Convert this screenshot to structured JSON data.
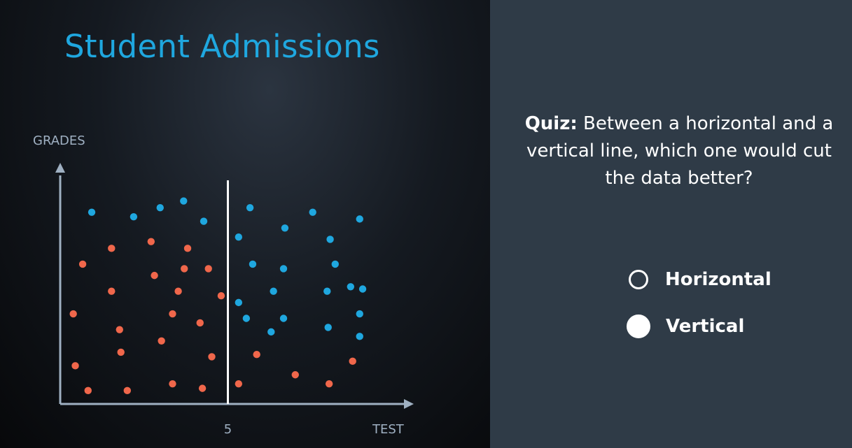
{
  "slide": {
    "title": "Student Admissions"
  },
  "quiz": {
    "lead": "Quiz:",
    "question": "Between a horizontal and a vertical line, which one would cut the data better?",
    "options": [
      {
        "label": "Horizontal",
        "selected": false
      },
      {
        "label": "Vertical",
        "selected": true
      }
    ]
  },
  "chart_data": {
    "type": "scatter",
    "xlabel": "TEST",
    "ylabel": "GRADES",
    "xlim": [
      0,
      10
    ],
    "ylim": [
      0,
      10
    ],
    "x_ticks": [
      5
    ],
    "grid": false,
    "divider": {
      "orientation": "vertical",
      "x": 5
    },
    "colors": {
      "blue": "#1fa7df",
      "red": "#f0674b",
      "axis": "#9fb0c2",
      "divider": "#ffffff"
    },
    "series": [
      {
        "color": "#1fa7df",
        "points": [
          [
            0.94,
            8.4
          ],
          [
            2.19,
            8.2
          ],
          [
            2.98,
            8.6
          ],
          [
            3.68,
            8.9
          ],
          [
            4.28,
            8.0
          ],
          [
            5.66,
            8.6
          ],
          [
            7.53,
            8.4
          ],
          [
            8.93,
            8.1
          ],
          [
            5.32,
            7.3
          ],
          [
            6.7,
            7.7
          ],
          [
            8.05,
            7.2
          ],
          [
            5.74,
            6.1
          ],
          [
            6.66,
            5.9
          ],
          [
            8.2,
            6.1
          ],
          [
            6.36,
            4.9
          ],
          [
            8.66,
            5.1
          ],
          [
            9.02,
            5.0
          ],
          [
            7.96,
            4.9
          ],
          [
            5.32,
            4.4
          ],
          [
            5.55,
            3.7
          ],
          [
            6.66,
            3.7
          ],
          [
            8.93,
            3.9
          ],
          [
            6.29,
            3.1
          ],
          [
            7.99,
            3.3
          ],
          [
            8.93,
            2.9
          ]
        ]
      },
      {
        "color": "#f0674b",
        "points": [
          [
            1.53,
            6.8
          ],
          [
            2.71,
            7.1
          ],
          [
            3.8,
            6.8
          ],
          [
            0.67,
            6.1
          ],
          [
            3.7,
            5.9
          ],
          [
            4.42,
            5.9
          ],
          [
            2.81,
            5.6
          ],
          [
            1.53,
            4.9
          ],
          [
            3.52,
            4.9
          ],
          [
            4.8,
            4.7
          ],
          [
            0.39,
            3.9
          ],
          [
            3.35,
            3.9
          ],
          [
            4.17,
            3.5
          ],
          [
            1.77,
            3.2
          ],
          [
            3.02,
            2.7
          ],
          [
            1.81,
            2.2
          ],
          [
            4.52,
            2.0
          ],
          [
            5.86,
            2.1
          ],
          [
            8.72,
            1.8
          ],
          [
            0.45,
            1.6
          ],
          [
            7.01,
            1.2
          ],
          [
            0.83,
            0.5
          ],
          [
            2.0,
            0.5
          ],
          [
            3.35,
            0.8
          ],
          [
            4.24,
            0.6
          ],
          [
            5.32,
            0.8
          ],
          [
            8.02,
            0.8
          ]
        ]
      }
    ]
  }
}
